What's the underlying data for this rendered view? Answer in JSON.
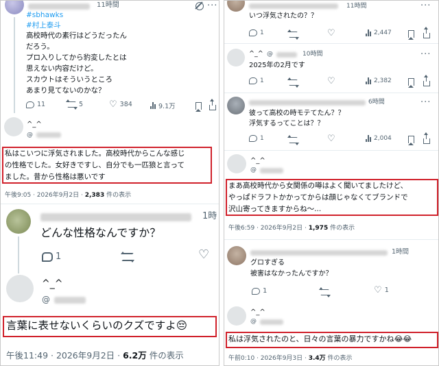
{
  "left": {
    "tweet1": {
      "time": "11時間",
      "hashtags": [
        "#sbhawks",
        "#村上泰斗"
      ],
      "lines": [
        "高校時代の素行はどうだったん",
        "だろう。",
        "プロ入りしてから豹変したとは",
        "思えない内容だけど。",
        "スカウトはそういうところ",
        "あまり見てないのかな？"
      ],
      "actions": {
        "replies": "11",
        "retweets": "5",
        "likes": "384",
        "views": "9.1万"
      }
    },
    "post1": {
      "name": "^_^",
      "handle": "@",
      "lines": [
        "私はこいつに浮気されました。高校時代からこんな感じ",
        "の性格でした。女好きですし、自分でも一匹狼と言って",
        "ました。昔から性格は悪いです"
      ],
      "meta_time": "午後9:05 · 2026年9月2日 · ",
      "meta_views": "2,383",
      "meta_suffix": " 件の表示"
    },
    "reply1": {
      "time": "1時",
      "text": "どんな性格なんですか？",
      "replies": "1"
    },
    "post2": {
      "name": "^_^",
      "handle": "@",
      "text": "言葉に表せないくらいのクズですよ",
      "emoji": "😔",
      "meta_time": "午後11:49 · 2026年9月2日 · ",
      "meta_views": "6.2万",
      "meta_suffix": " 件の表示"
    }
  },
  "right": {
    "r1": {
      "time": "11時間",
      "text": "いつ浮気されたの？？",
      "replies": "1",
      "views": "2,447"
    },
    "r2": {
      "name": "^_^",
      "handle": "@",
      "time": "10時間",
      "text": "2025年の2月です",
      "replies": "1",
      "views": "2,382"
    },
    "r3": {
      "time": "6時間",
      "lines": [
        "彼って高校の時モテてたん？？",
        "浮気するってことは？？"
      ],
      "replies": "1",
      "views": "2,004"
    },
    "post3": {
      "name": "^_^",
      "handle": "@",
      "lines": [
        "まあ高校時代から女関係の噂はよく聞いてましたけど、",
        "やっぱドラフトかかってからは顔じゃなくてブランドで",
        "沢山寄ってきますからね〜..."
      ],
      "meta_time": "午後6:59 · 2026年9月2日 · ",
      "meta_views": "1,975",
      "meta_suffix": " 件の表示"
    },
    "r4": {
      "time": "1時間",
      "lines": [
        "グロすぎる",
        "被害はなかったんですか？"
      ],
      "replies": "1",
      "likes": "1"
    },
    "post4": {
      "name": "^_^",
      "handle": "@",
      "text": "私は浮気されたのと、日々の言葉の暴力ですかね",
      "emoji": "😂😂",
      "meta_time": "午前0:10 · 2026年9月3日 · ",
      "meta_views": "3.4万",
      "meta_suffix": " 件の表示"
    }
  },
  "icons": {
    "reply": "reply-icon",
    "retweet": "retweet-icon",
    "like": "heart-icon",
    "views": "views-icon",
    "bookmark": "bookmark-icon",
    "share": "share-icon",
    "grok": "grok-icon",
    "more": "more-icon"
  },
  "colors": {
    "highlight_border": "#d0202a",
    "hashtag": "#1d9bf0",
    "muted": "#536471"
  }
}
